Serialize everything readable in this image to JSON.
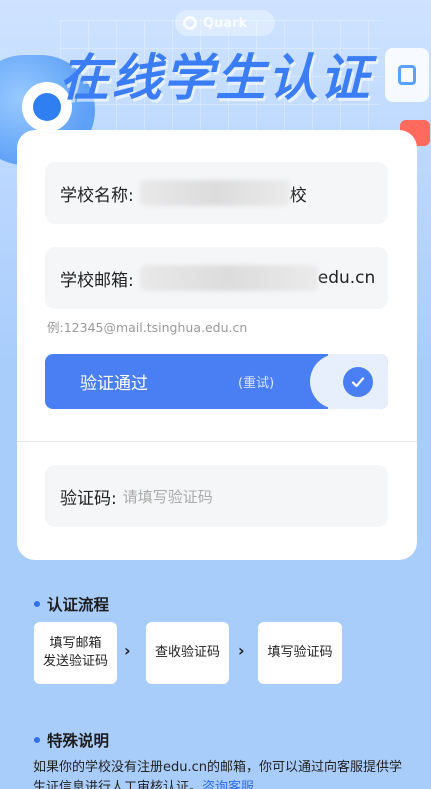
{
  "header": {
    "title": "在线学生认证",
    "brand_chip": "Quark"
  },
  "form": {
    "school_name_label": "学校名称:",
    "school_name_value_tail": "校",
    "school_email_label": "学校邮箱:",
    "school_email_value_tail": "edu.cn",
    "email_hint": "例:12345@mail.tsinghua.edu.cn",
    "verify_button_label": "验证通过",
    "retry_label": "(重试)",
    "code_label": "验证码:",
    "code_placeholder": "请填写验证码"
  },
  "process": {
    "title": "认证流程",
    "steps": [
      {
        "line1": "填写邮箱",
        "line2": "发送验证码"
      },
      {
        "line1": "查收验证码",
        "line2": ""
      },
      {
        "line1": "填写验证码",
        "line2": ""
      }
    ]
  },
  "special": {
    "title": "特殊说明",
    "text": "如果你的学校没有注册edu.cn的邮箱，你可以通过向客服提供学生证信息进行人工审核认证。",
    "link": "咨询客服"
  },
  "colors": {
    "accent": "#4a7ff3",
    "title_blue": "#3b7df5",
    "background": "#a9cdfb"
  }
}
